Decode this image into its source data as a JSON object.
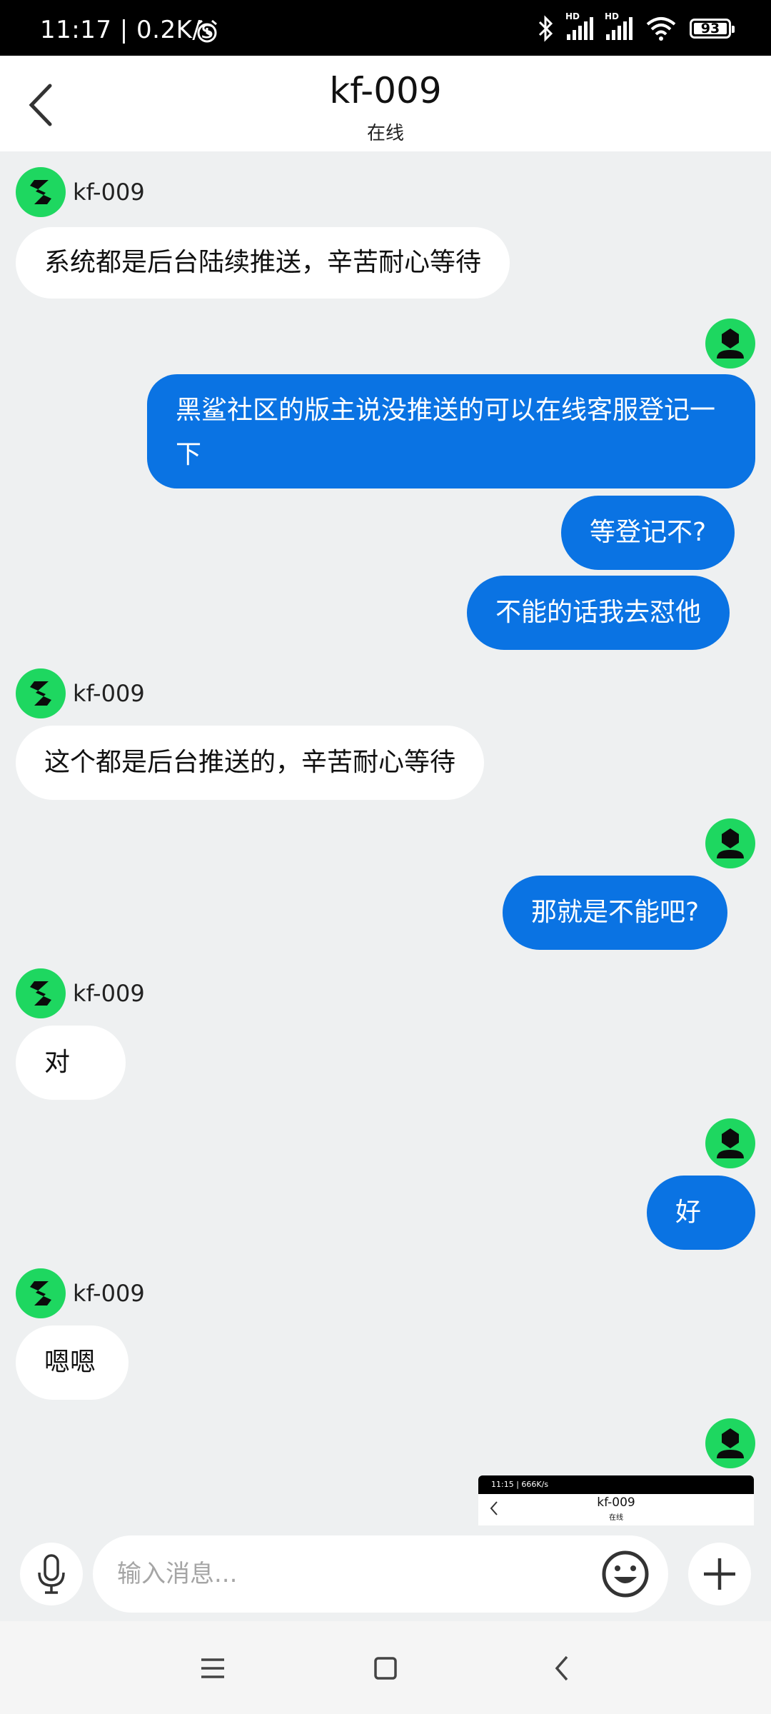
{
  "status_bar": {
    "time": "11:17 | 0.2K/s",
    "signal1_label": "HD",
    "signal2_label": "HD",
    "battery": "93"
  },
  "header": {
    "title": "kf-009",
    "subtitle": "在线"
  },
  "messages": [
    {
      "from": "agent",
      "sender": "kf-009",
      "text": "系统都是后台陆续推送，辛苦耐心等待"
    },
    {
      "from": "me",
      "text": "黑鲨社区的版主说没推送的可以在线客服登记一下"
    },
    {
      "from": "me",
      "text": "等登记不?"
    },
    {
      "from": "me",
      "text": "不能的话我去怼他"
    },
    {
      "from": "agent",
      "sender": "kf-009",
      "text": "这个都是后台推送的，辛苦耐心等待"
    },
    {
      "from": "me",
      "text": "那就是不能吧?"
    },
    {
      "from": "agent",
      "sender": "kf-009",
      "text": "对"
    },
    {
      "from": "me",
      "text": "好"
    },
    {
      "from": "agent",
      "sender": "kf-009",
      "text": "嗯嗯"
    }
  ],
  "attachment_screenshot": {
    "status": "11:15 | 666K/s",
    "title": "kf-009",
    "subtitle": "在线"
  },
  "input": {
    "placeholder": "输入消息..."
  },
  "colors": {
    "accent_blue": "#0a73e3",
    "avatar_green": "#1ed760",
    "background": "#eef0f1"
  },
  "icons": {
    "voice": "microphone-icon",
    "emoji": "emoji-icon",
    "more": "plus-icon",
    "back": "chevron-left-icon"
  }
}
